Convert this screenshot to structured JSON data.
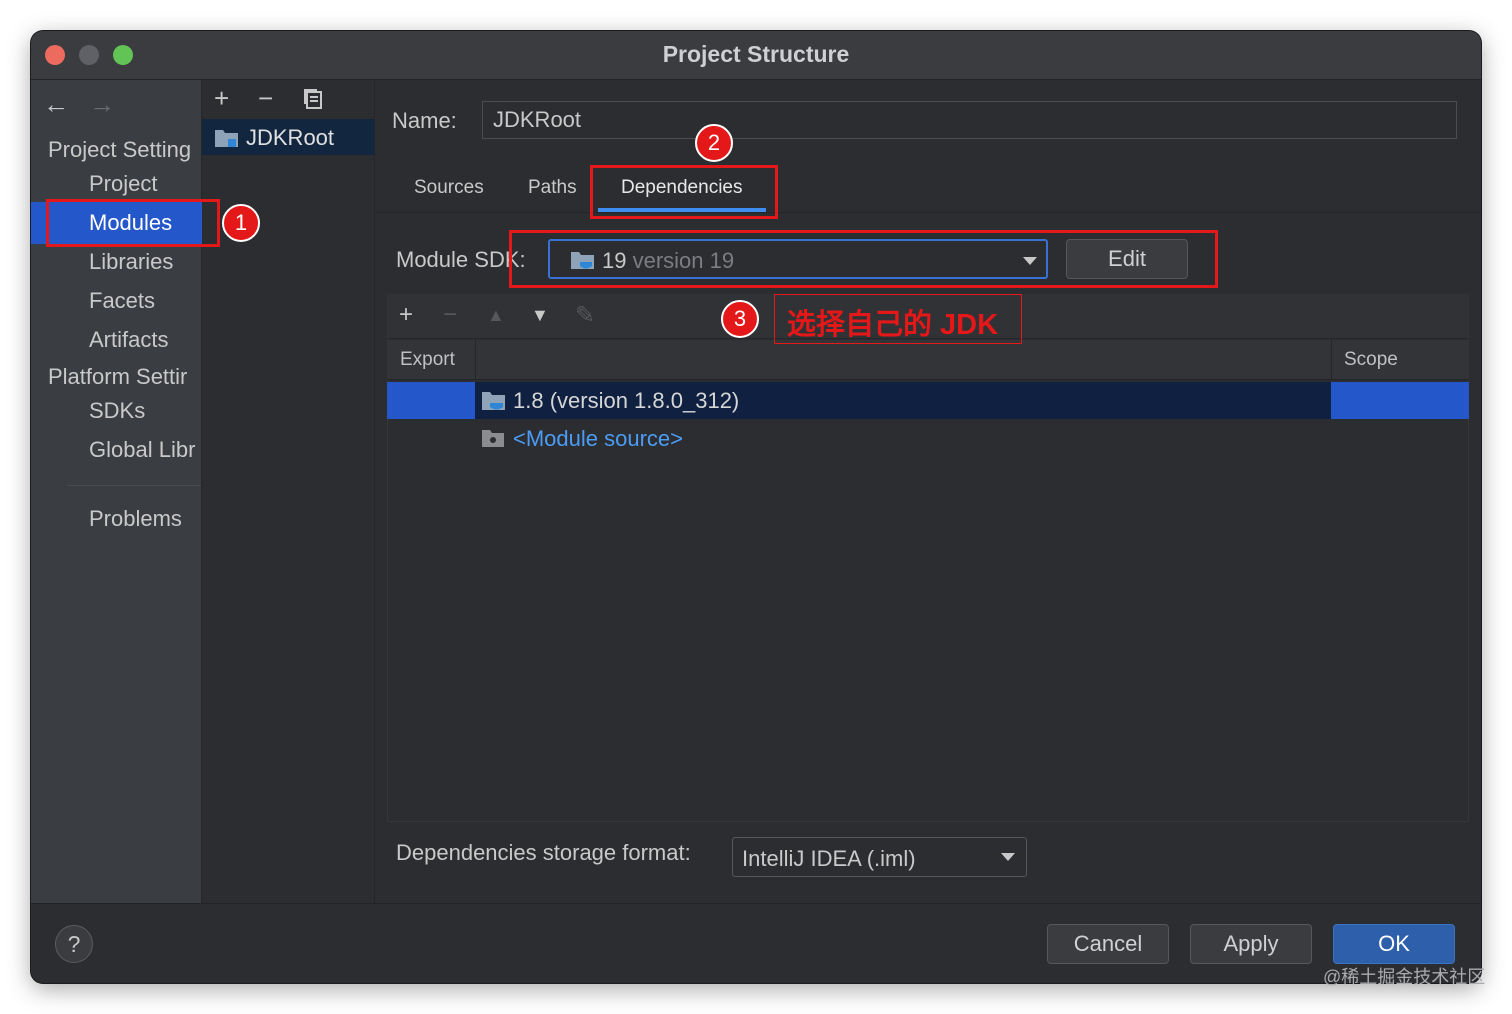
{
  "window": {
    "title": "Project Structure"
  },
  "nav": {
    "back_icon": "arrow-left-icon",
    "forward_icon": "arrow-right-icon",
    "project_settings_header": "Project Setting",
    "platform_settings_header": "Platform Settir",
    "items": [
      {
        "label": "Project"
      },
      {
        "label": "Modules",
        "selected": true
      },
      {
        "label": "Libraries"
      },
      {
        "label": "Facets"
      },
      {
        "label": "Artifacts"
      },
      {
        "label": "SDKs"
      },
      {
        "label": "Global Libr"
      },
      {
        "label": "Problems"
      }
    ]
  },
  "modules": {
    "toolbar": {
      "add": "+",
      "remove": "−",
      "copy_icon": "copy-icon"
    },
    "list": [
      {
        "label": "JDKRoot",
        "icon": "module-folder-icon"
      }
    ]
  },
  "module": {
    "name_label": "Name:",
    "name_value": "JDKRoot",
    "tabs": [
      {
        "label": "Sources"
      },
      {
        "label": "Paths"
      },
      {
        "label": "Dependencies",
        "active": true
      }
    ],
    "sdk_label": "Module SDK:",
    "sdk_value": "19",
    "sdk_version": "version 19",
    "edit_label": "Edit"
  },
  "dependencies": {
    "toolbar_icons": [
      "add-icon",
      "remove-icon",
      "move-up-icon",
      "move-down-icon",
      "edit-icon"
    ],
    "columns": {
      "export": "Export",
      "scope": "Scope"
    },
    "rows": [
      {
        "label": "1.8 (version 1.8.0_312)",
        "icon": "jdk-folder-icon",
        "selected": true
      },
      {
        "label": "<Module source>",
        "icon": "source-folder-icon",
        "link": true
      }
    ],
    "storage_format_label": "Dependencies storage format:",
    "storage_format_value": "IntelliJ IDEA (.iml)"
  },
  "footer": {
    "help": "?",
    "cancel": "Cancel",
    "apply": "Apply",
    "ok": "OK"
  },
  "annotations": {
    "step1": "1",
    "step2": "2",
    "step3": "3",
    "note": "选择自己的 JDK",
    "color": "#e41818"
  },
  "watermark": "@稀土掘金技术社区",
  "colors": {
    "window_bg": "#2b2d30",
    "selection": "#2457c9",
    "accent_tab": "#3d8ef0",
    "link": "#4c9cf5"
  }
}
